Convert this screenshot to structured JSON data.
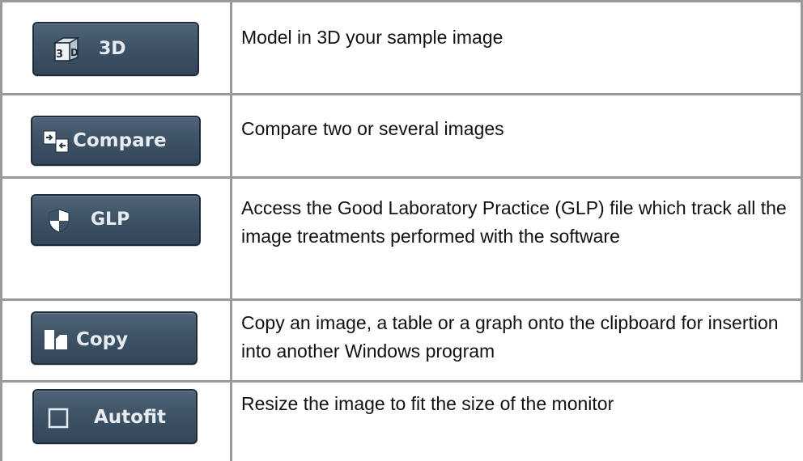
{
  "rows": [
    {
      "button_label": "3D",
      "icon": "cube-3d-icon",
      "description": "Model in 3D your sample image"
    },
    {
      "button_label": "Compare",
      "icon": "compare-icon",
      "description": "Compare two or several images"
    },
    {
      "button_label": "GLP",
      "icon": "shield-icon",
      "description": "Access the Good Laboratory Practice (GLP) file which track all the image treatments performed with the software"
    },
    {
      "button_label": "Copy",
      "icon": "copy-icon",
      "description": "Copy an image, a table or a graph onto the clipboard for insertion into another Windows program"
    },
    {
      "button_label": "Autofit",
      "icon": "autofit-square-icon",
      "description": "Resize the image to fit the size of the monitor"
    }
  ],
  "colors": {
    "border": "#9a9a9a",
    "button_bg": "#3f5366",
    "button_text": "#e6ecf2"
  }
}
